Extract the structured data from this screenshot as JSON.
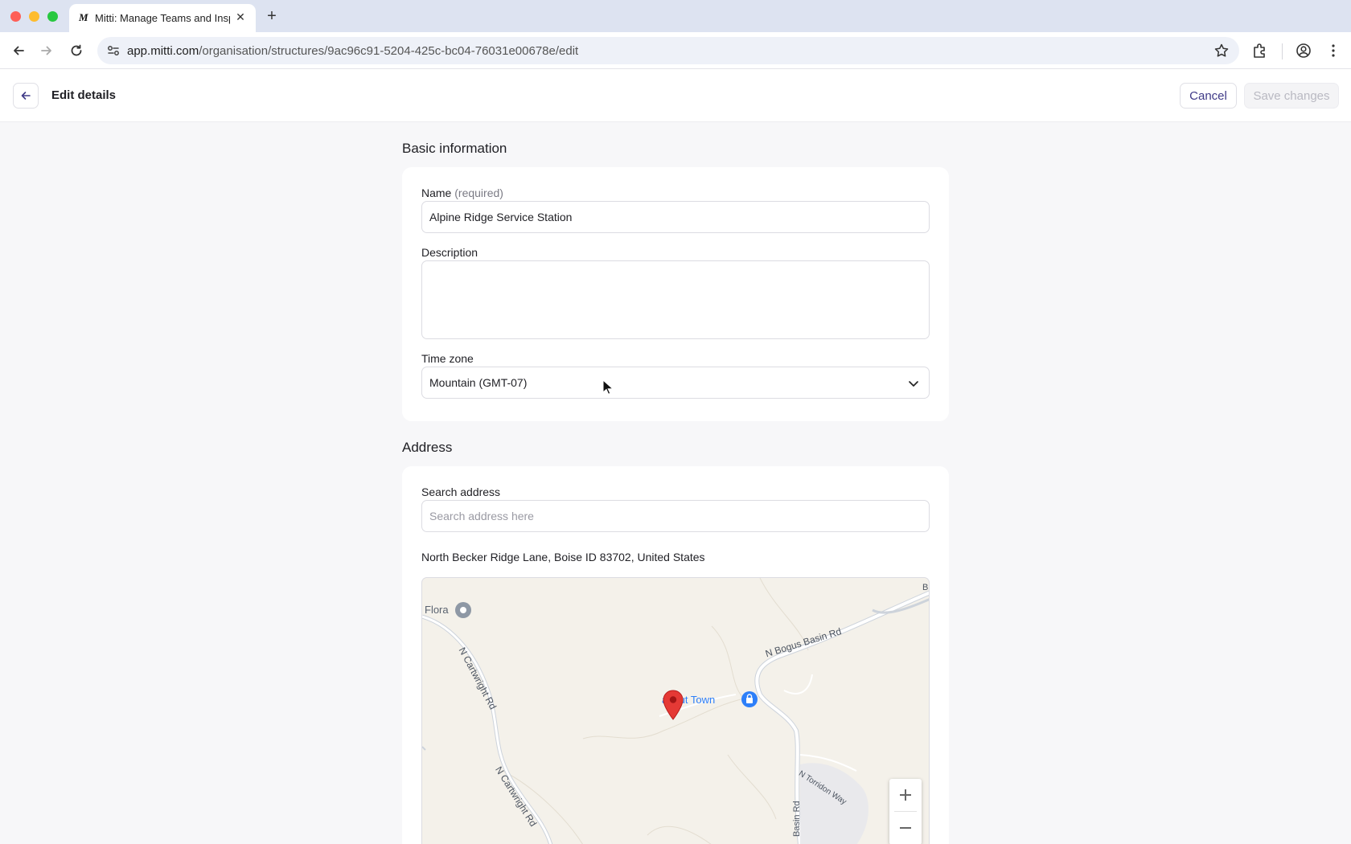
{
  "browser": {
    "tab_title": "Mitti: Manage Teams and Inspections",
    "tab_favicon": "M",
    "url_host": "app.mitti.com",
    "url_path": "/organisation/structures/9ac96c91-5204-425c-bc04-76031e00678e/edit"
  },
  "header": {
    "title": "Edit details",
    "cancel_label": "Cancel",
    "save_label": "Save changes"
  },
  "basic_info": {
    "section_title": "Basic information",
    "name_label": "Name",
    "name_required": "(required)",
    "name_value": "Alpine Ridge Service Station",
    "description_label": "Description",
    "description_value": "",
    "timezone_label": "Time zone",
    "timezone_value": "Mountain (GMT-07)"
  },
  "address": {
    "section_title": "Address",
    "search_label": "Search address",
    "search_placeholder": "Search address here",
    "current_address": "North Becker Ridge Lane, Boise ID 83702, United States"
  },
  "map": {
    "labels": {
      "flora": "Flora",
      "cartwright_upper": "N Cartwright Rd",
      "cartwright_lower": "N Cartwright Rd",
      "bogus_basin": "N Bogus Basin Rd",
      "basin_rd": "Basin Rd",
      "torridon": "N Torridon Way",
      "poi": "Ooh-about Town",
      "poi_visible": "about Town",
      "edge_letter": "B"
    },
    "colors": {
      "background": "#f4f1ea",
      "road": "#ffffff",
      "road_casing": "#cdd3db",
      "poi_blue": "#2d7ff9",
      "pin_red": "#e53935"
    }
  }
}
